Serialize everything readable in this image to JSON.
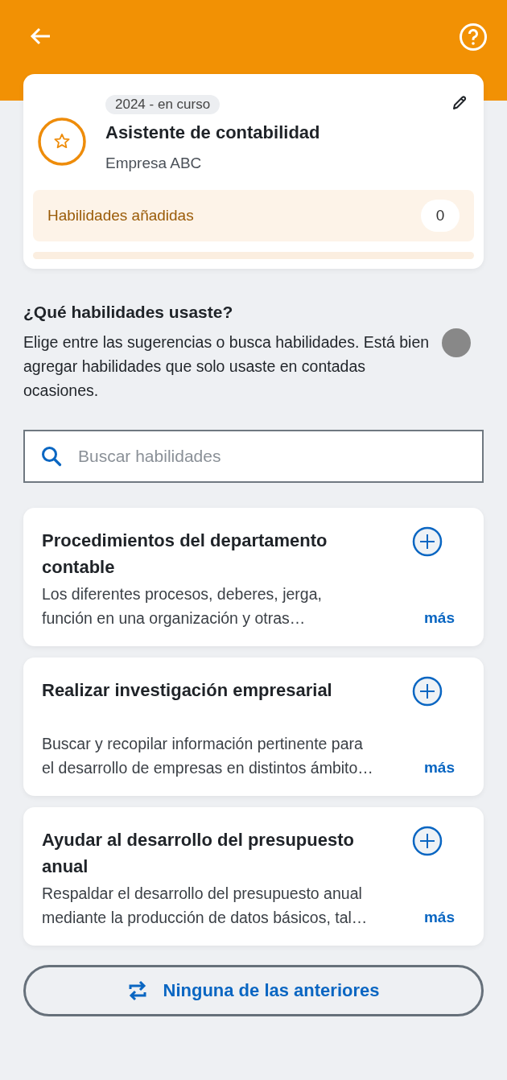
{
  "job_card": {
    "period": "2024 - en curso",
    "title": "Asistente de contabilidad",
    "company": "Empresa ABC",
    "skills_label": "Habilidades añadidas",
    "skills_count": "0",
    "progress": {
      "level": 0
    }
  },
  "question": {
    "title": "¿Qué habilidades usaste?",
    "description": "Elige entre las sugerencias o busca habilidades. Está bien agregar habilidades que solo usaste en contadas ocasiones."
  },
  "search": {
    "placeholder": "Buscar habilidades"
  },
  "suggestions": [
    {
      "title": "Procedimientos del departamento contable",
      "lines": [
        "Los diferentes procesos, deberes, jerga,",
        "función en una organización y otras…"
      ],
      "more": "más"
    },
    {
      "title": "Realizar investigación empresarial",
      "lines": [
        "Buscar y recopilar información pertinente para",
        "el desarrollo de empresas en distintos ámbito…"
      ],
      "more": "más"
    },
    {
      "title": "Ayudar al desarrollo del presupuesto anual",
      "lines": [
        "Respaldar el desarrollo del presupuesto anual",
        "mediante la producción de datos básicos, tal…"
      ],
      "more": "más"
    }
  ],
  "none_button": {
    "label": "Ninguna de las anteriores"
  }
}
